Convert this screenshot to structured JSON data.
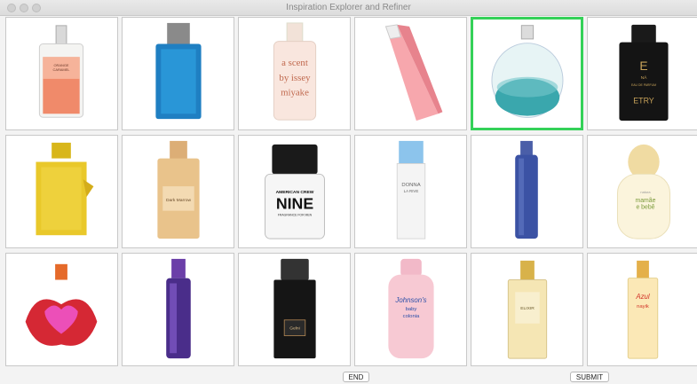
{
  "window": {
    "title": "Inspiration Explorer and Refiner"
  },
  "grid": {
    "selected_index": 4,
    "items": [
      {
        "name": "bottle-orange-label",
        "label_lines": [
          "ORANGE",
          "CARAMEL"
        ]
      },
      {
        "name": "bottle-blue-square",
        "label_lines": []
      },
      {
        "name": "bottle-a-scent-issey-miyake",
        "label_lines": [
          "a scent",
          "by issey",
          "miyake"
        ]
      },
      {
        "name": "bottle-pink-cone",
        "label_lines": []
      },
      {
        "name": "bottle-teal-round",
        "label_lines": []
      },
      {
        "name": "bottle-black-gold-e",
        "label_lines": [
          "NĀ",
          "EAU DE PARFUM",
          "ETRY"
        ]
      },
      {
        "name": "bottle-yellow-gold",
        "label_lines": []
      },
      {
        "name": "bottle-dark-marrow",
        "label_lines": [
          "Dark Marrow"
        ]
      },
      {
        "name": "bottle-american-crew-nine",
        "label_lines": [
          "AMERICAN CREW",
          "NINE",
          "FRAGRANCE FOR MEN"
        ]
      },
      {
        "name": "bottle-donna-la-rive",
        "label_lines": [
          "DONNA",
          "LA RIVE"
        ]
      },
      {
        "name": "bottle-blue-tall",
        "label_lines": []
      },
      {
        "name": "bottle-mamae-e-bebe",
        "label_lines": [
          "mamãe",
          "e bebê",
          "natura"
        ]
      },
      {
        "name": "bottle-red-lips",
        "label_lines": []
      },
      {
        "name": "bottle-purple-spray",
        "label_lines": []
      },
      {
        "name": "bottle-black-sparkle",
        "label_lines": [
          "Gelni"
        ]
      },
      {
        "name": "bottle-johnsons-baby-colonia",
        "label_lines": [
          "Johnson's",
          "baby",
          "colonia"
        ]
      },
      {
        "name": "bottle-gold-clear",
        "label_lines": [
          "ELIXIR"
        ]
      },
      {
        "name": "bottle-azul-tall",
        "label_lines": [
          "Azul",
          "nayik"
        ]
      }
    ]
  },
  "footer": {
    "end_label": "END",
    "submit_label": "SUBMIT"
  },
  "colors": {
    "selection": "#34d158"
  }
}
